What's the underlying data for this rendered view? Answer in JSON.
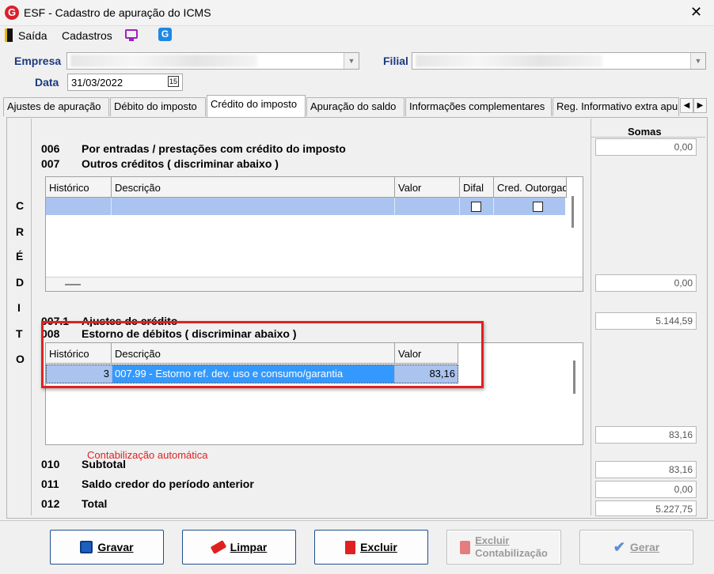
{
  "window": {
    "title": "ESF - Cadastro de apuração do ICMS",
    "logo_letter": "G",
    "close_glyph": "✕"
  },
  "menu": {
    "items": [
      "Saída",
      "Cadastros"
    ]
  },
  "header": {
    "empresa_label": "Empresa",
    "filial_label": "Filial",
    "data_label": "Data",
    "data_value": "31/03/2022",
    "calendar_glyph": "15"
  },
  "tabs": [
    "Ajustes de apuração",
    "Débito do imposto",
    "Crédito do imposto",
    "Apuração do saldo",
    "Informações complementares",
    "Reg. Informativo extra apu"
  ],
  "active_tab": "Crédito do imposto",
  "side_label": [
    "C",
    "R",
    "É",
    "D",
    "I",
    "T",
    "O"
  ],
  "somas_label": "Somas",
  "rows": {
    "r006": {
      "code": "006",
      "text": "Por entradas / prestações com crédito do imposto",
      "sum": "0,00"
    },
    "r007": {
      "code": "007",
      "text": "Outros créditos ( discriminar abaixo )",
      "sum": "0,00"
    },
    "r007_1": {
      "code": "007.1",
      "text": "Ajustes de crédito",
      "sum": "5.144,59"
    },
    "r008": {
      "code": "008",
      "text": "Estorno de débitos ( discriminar abaixo )",
      "sum": "83,16"
    },
    "r010": {
      "code": "010",
      "text": "Subtotal",
      "sum": "83,16"
    },
    "r011": {
      "code": "011",
      "text": "Saldo credor do período anterior",
      "sum": "0,00"
    },
    "r012": {
      "code": "012",
      "text": "Total",
      "sum": "5.227,75"
    }
  },
  "grid1": {
    "headers": [
      "Histórico",
      "Descrição",
      "Valor",
      "Difal",
      "Cred. Outorgado"
    ]
  },
  "grid2": {
    "headers": [
      "Histórico",
      "Descrição",
      "Valor"
    ],
    "rows": [
      {
        "historico": "3",
        "descricao": "007.99 - Estorno ref. dev. uso e consumo/garantia",
        "valor": "83,16"
      }
    ]
  },
  "contabilizacao": "Contabilização automática",
  "colors": {
    "accent": "#1c3a82",
    "highlight": "#3399ff",
    "selected_row": "#aac4ef",
    "annotation_red": "#e02020"
  },
  "buttons": {
    "gravar": "Gravar",
    "limpar": "Limpar",
    "excluir": "Excluir",
    "excluir_contab_1": "Excluir",
    "excluir_contab_2": "Contabilização",
    "gerar": "Gerar"
  }
}
